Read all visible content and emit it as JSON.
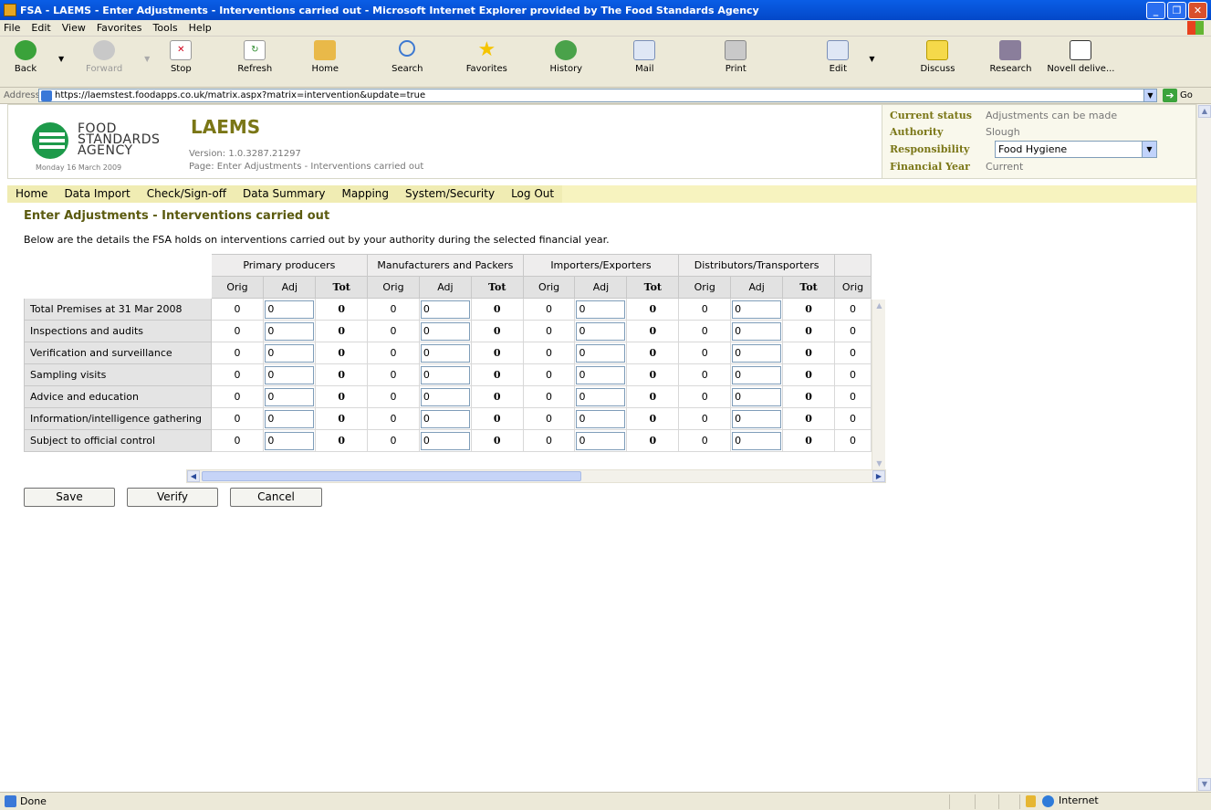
{
  "window": {
    "title": "FSA - LAEMS - Enter Adjustments - Interventions carried out - Microsoft Internet Explorer provided by The Food Standards Agency"
  },
  "menu": [
    "File",
    "Edit",
    "View",
    "Favorites",
    "Tools",
    "Help"
  ],
  "toolbar": {
    "back": "Back",
    "forward": "Forward",
    "stop": "Stop",
    "refresh": "Refresh",
    "home": "Home",
    "search": "Search",
    "favorites": "Favorites",
    "history": "History",
    "mail": "Mail",
    "print": "Print",
    "edit": "Edit",
    "discuss": "Discuss",
    "research": "Research",
    "novell": "Novell delive..."
  },
  "address": {
    "label": "Address",
    "url": "https://laemstest.foodapps.co.uk/matrix.aspx?matrix=intervention&update=true",
    "go": "Go"
  },
  "header": {
    "logo_lines": [
      "FOOD",
      "STANDARDS",
      "AGENCY"
    ],
    "app_name": "LAEMS",
    "version": "Version: 1.0.3287.21297",
    "page": "Page: Enter Adjustments - Interventions carried out",
    "date": "Monday 16 March 2009"
  },
  "status": {
    "current_status_label": "Current status",
    "current_status_value": "Adjustments can be made",
    "authority_label": "Authority",
    "authority_value": "Slough",
    "responsibility_label": "Responsibility",
    "responsibility_value": "Food Hygiene",
    "financial_year_label": "Financial Year",
    "financial_year_value": "Current"
  },
  "nav": [
    "Home",
    "Data Import",
    "Check/Sign-off",
    "Data Summary",
    "Mapping",
    "System/Security",
    "Log Out"
  ],
  "page_title": "Enter Adjustments - Interventions carried out",
  "intro": "Below are the details the FSA holds on interventions carried out by your authority during the selected financial year.",
  "grid": {
    "groups": [
      "Primary producers",
      "Manufacturers and Packers",
      "Importers/Exporters",
      "Distributors/Transporters",
      ""
    ],
    "sub_headers": [
      "Orig",
      "Adj",
      "Tot"
    ],
    "partial_sub_header": "Orig",
    "rows": [
      {
        "label": "Total Premises at 31 Mar 2008",
        "orig": "0",
        "adj": "0",
        "tot": "0"
      },
      {
        "label": "Inspections and audits",
        "orig": "0",
        "adj": "0",
        "tot": "0"
      },
      {
        "label": "Verification and surveillance",
        "orig": "0",
        "adj": "0",
        "tot": "0"
      },
      {
        "label": "Sampling visits",
        "orig": "0",
        "adj": "0",
        "tot": "0"
      },
      {
        "label": "Advice and education",
        "orig": "0",
        "adj": "0",
        "tot": "0"
      },
      {
        "label": "Information/intelligence gathering",
        "orig": "0",
        "adj": "0",
        "tot": "0"
      },
      {
        "label": "Subject to official control",
        "orig": "0",
        "adj": "0",
        "tot": "0"
      }
    ]
  },
  "buttons": {
    "save": "Save",
    "verify": "Verify",
    "cancel": "Cancel"
  },
  "statusbar": {
    "text": "Done",
    "zone": "Internet"
  }
}
